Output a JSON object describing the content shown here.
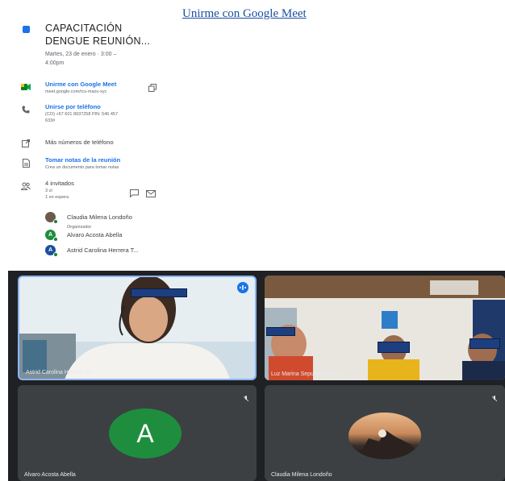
{
  "top_link": "Unirme con Google Meet",
  "event": {
    "title_line1": "CAPACITACIÓN",
    "title_line2": "DENGUE REUNIÓN...",
    "date_line1": "Martes, 23 de enero  ·  3:00 –",
    "date_line2": "4:00pm"
  },
  "meet_link": {
    "label": "Unirme con Google Meet",
    "url": "meet.google.com/rcs-mazu-xyc"
  },
  "phone": {
    "label": "Unirse por teléfono",
    "line1": "(CO) +57 601 8937258 PIN: 546 457",
    "line2": "633#"
  },
  "more_numbers": "Más números de teléfono",
  "notes": {
    "label": "Tomar notas de la reunión",
    "sub": "Crea un documento para tomar notas"
  },
  "guests": {
    "count": "4 invitados",
    "yes": "3 sí",
    "waiting": "1 en espera",
    "list": [
      {
        "name": "Claudia Milena Londoño",
        "role": "Organizador",
        "initial": ""
      },
      {
        "name": "Alvaro Acosta Abella",
        "initial": "A"
      },
      {
        "name": "Astrid Carolina Herrera T...",
        "initial": "A"
      }
    ]
  },
  "tiles": [
    {
      "name": "Astrid Carolina Herrera Tr..."
    },
    {
      "name": "Luz Marina Sepulveda Marín"
    },
    {
      "name": "Alvaro Acosta Abella",
      "initial": "A"
    },
    {
      "name": "Claudia Milena Londoño"
    }
  ],
  "colors": {
    "accent": "#1a73e8",
    "meet_bg": "#202124",
    "tile_bg": "#3c4043",
    "avatar_green": "#1e8e3e",
    "redact": "#1d3f80"
  }
}
